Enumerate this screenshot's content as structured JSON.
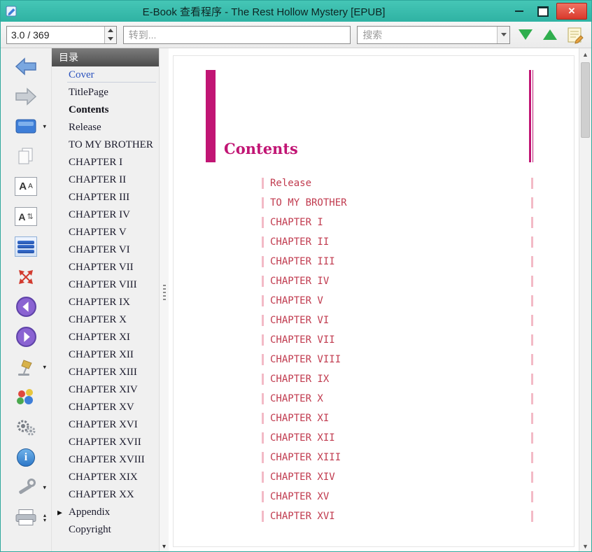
{
  "window": {
    "title": "E-Book 查看程序 - The Rest Hollow Mystery [EPUB]"
  },
  "toolbar": {
    "page_indicator": "3.0 / 369",
    "goto_placeholder": "转到...",
    "search_placeholder": "搜索"
  },
  "left_toolbar": {
    "icons": [
      "back-arrow",
      "forward-arrow",
      "view-mode",
      "copy-page",
      "font-size",
      "font-family",
      "toc-lines",
      "fullscreen",
      "prev-page",
      "next-page",
      "lamp",
      "theme-palette",
      "settings-gears",
      "info",
      "tools",
      "print"
    ]
  },
  "toc": {
    "header": "目录",
    "items": [
      {
        "label": "Cover",
        "link": true
      },
      {
        "label": "TitlePage"
      },
      {
        "label": "Contents",
        "current": true
      },
      {
        "label": "Release"
      },
      {
        "label": "TO MY BROTHER"
      },
      {
        "label": "CHAPTER I"
      },
      {
        "label": "CHAPTER II"
      },
      {
        "label": "CHAPTER III"
      },
      {
        "label": "CHAPTER IV"
      },
      {
        "label": "CHAPTER V"
      },
      {
        "label": "CHAPTER VI"
      },
      {
        "label": "CHAPTER VII"
      },
      {
        "label": "CHAPTER VIII"
      },
      {
        "label": "CHAPTER IX"
      },
      {
        "label": "CHAPTER X"
      },
      {
        "label": "CHAPTER XI"
      },
      {
        "label": "CHAPTER XII"
      },
      {
        "label": "CHAPTER XIII"
      },
      {
        "label": "CHAPTER XIV"
      },
      {
        "label": "CHAPTER XV"
      },
      {
        "label": "CHAPTER XVI"
      },
      {
        "label": "CHAPTER XVII"
      },
      {
        "label": "CHAPTER XVIII"
      },
      {
        "label": "CHAPTER XIX"
      },
      {
        "label": "CHAPTER XX"
      },
      {
        "label": "Appendix",
        "expandable": true
      },
      {
        "label": "Copyright"
      }
    ]
  },
  "content": {
    "title": "Contents",
    "links": [
      "Release",
      "TO MY BROTHER",
      "CHAPTER I",
      "CHAPTER II",
      "CHAPTER III",
      "CHAPTER IV",
      "CHAPTER V",
      "CHAPTER VI",
      "CHAPTER VII",
      "CHAPTER VIII",
      "CHAPTER IX",
      "CHAPTER X",
      "CHAPTER XI",
      "CHAPTER XII",
      "CHAPTER XIII",
      "CHAPTER XIV",
      "CHAPTER XV",
      "CHAPTER XVI"
    ]
  },
  "colors": {
    "accent_magenta": "#c11574",
    "link_blue": "#2a52be",
    "titlebar_teal": "#35b9ab",
    "close_red": "#d93a2c",
    "find_green": "#2fae4e",
    "link_pink_bar": "#f3bac6",
    "content_link": "#c03a4e"
  }
}
